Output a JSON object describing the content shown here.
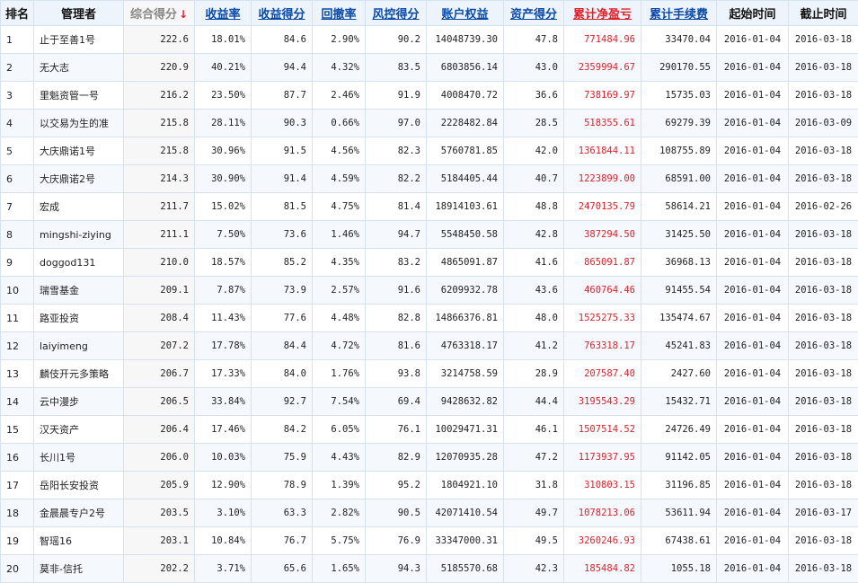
{
  "headers": {
    "rank": "排名",
    "manager": "管理者",
    "score": "综合得分",
    "return_rate": "收益率",
    "return_score": "收益得分",
    "drawdown": "回撤率",
    "risk_score": "风控得分",
    "equity": "账户权益",
    "asset_score": "资产得分",
    "net_profit": "累计净盈亏",
    "fees": "累计手续费",
    "start": "起始时间",
    "end": "截止时间",
    "sort_arrow": "↓"
  },
  "rows": [
    [
      "1",
      "止于至善1号",
      "222.6",
      "18.01%",
      "84.6",
      "2.90%",
      "90.2",
      "14048739.30",
      "47.8",
      "771484.96",
      "33470.04",
      "2016-01-04",
      "2016-03-18"
    ],
    [
      "2",
      "无大志",
      "220.9",
      "40.21%",
      "94.4",
      "4.32%",
      "83.5",
      "6803856.14",
      "43.0",
      "2359994.67",
      "290170.55",
      "2016-01-04",
      "2016-03-18"
    ],
    [
      "3",
      "里魁资管一号",
      "216.2",
      "23.50%",
      "87.7",
      "2.46%",
      "91.9",
      "4008470.72",
      "36.6",
      "738169.97",
      "15735.03",
      "2016-01-04",
      "2016-03-18"
    ],
    [
      "4",
      "以交易为生的准",
      "215.8",
      "28.11%",
      "90.3",
      "0.66%",
      "97.0",
      "2228482.84",
      "28.5",
      "518355.61",
      "69279.39",
      "2016-01-04",
      "2016-03-09"
    ],
    [
      "5",
      "大庆鼎诺1号",
      "215.8",
      "30.96%",
      "91.5",
      "4.56%",
      "82.3",
      "5760781.85",
      "42.0",
      "1361844.11",
      "108755.89",
      "2016-01-04",
      "2016-03-18"
    ],
    [
      "6",
      "大庆鼎诺2号",
      "214.3",
      "30.90%",
      "91.4",
      "4.59%",
      "82.2",
      "5184405.44",
      "40.7",
      "1223899.00",
      "68591.00",
      "2016-01-04",
      "2016-03-18"
    ],
    [
      "7",
      "宏成",
      "211.7",
      "15.02%",
      "81.5",
      "4.75%",
      "81.4",
      "18914103.61",
      "48.8",
      "2470135.79",
      "58614.21",
      "2016-01-04",
      "2016-02-26"
    ],
    [
      "8",
      "mingshi-ziying",
      "211.1",
      "7.50%",
      "73.6",
      "1.46%",
      "94.7",
      "5548450.58",
      "42.8",
      "387294.50",
      "31425.50",
      "2016-01-04",
      "2016-03-18"
    ],
    [
      "9",
      "doggod131",
      "210.0",
      "18.57%",
      "85.2",
      "4.35%",
      "83.2",
      "4865091.87",
      "41.6",
      "865091.87",
      "36968.13",
      "2016-01-04",
      "2016-03-18"
    ],
    [
      "10",
      "瑞雪基金",
      "209.1",
      "7.87%",
      "73.9",
      "2.57%",
      "91.6",
      "6209932.78",
      "43.6",
      "460764.46",
      "91455.54",
      "2016-01-04",
      "2016-03-18"
    ],
    [
      "11",
      "路亚投资",
      "208.4",
      "11.43%",
      "77.6",
      "4.48%",
      "82.8",
      "14866376.81",
      "48.0",
      "1525275.33",
      "135474.67",
      "2016-01-04",
      "2016-03-18"
    ],
    [
      "12",
      "laiyimeng",
      "207.2",
      "17.78%",
      "84.4",
      "4.72%",
      "81.6",
      "4763318.17",
      "41.2",
      "763318.17",
      "45241.83",
      "2016-01-04",
      "2016-03-18"
    ],
    [
      "13",
      "麟伎开元多策略",
      "206.7",
      "17.33%",
      "84.0",
      "1.76%",
      "93.8",
      "3214758.59",
      "28.9",
      "207587.40",
      "2427.60",
      "2016-01-04",
      "2016-03-18"
    ],
    [
      "14",
      "云中漫步",
      "206.5",
      "33.84%",
      "92.7",
      "7.54%",
      "69.4",
      "9428632.82",
      "44.4",
      "3195543.29",
      "15432.71",
      "2016-01-04",
      "2016-03-18"
    ],
    [
      "15",
      "汉天资产",
      "206.4",
      "17.46%",
      "84.2",
      "6.05%",
      "76.1",
      "10029471.31",
      "46.1",
      "1507514.52",
      "24726.49",
      "2016-01-04",
      "2016-03-18"
    ],
    [
      "16",
      "长川1号",
      "206.0",
      "10.03%",
      "75.9",
      "4.43%",
      "82.9",
      "12070935.28",
      "47.2",
      "1173937.95",
      "91142.05",
      "2016-01-04",
      "2016-03-18"
    ],
    [
      "17",
      "岳阳长安投资",
      "205.9",
      "12.90%",
      "78.9",
      "1.39%",
      "95.2",
      "1804921.10",
      "31.8",
      "310803.15",
      "31196.85",
      "2016-01-04",
      "2016-03-18"
    ],
    [
      "18",
      "金晨晨专户2号",
      "203.5",
      "3.10%",
      "63.3",
      "2.82%",
      "90.5",
      "42071410.54",
      "49.7",
      "1078213.06",
      "53611.94",
      "2016-01-04",
      "2016-03-17"
    ],
    [
      "19",
      "智瑶16",
      "203.1",
      "10.84%",
      "76.7",
      "5.75%",
      "76.9",
      "33347000.31",
      "49.5",
      "3260246.93",
      "67438.61",
      "2016-01-04",
      "2016-03-18"
    ],
    [
      "20",
      "莫非-信托",
      "202.2",
      "3.71%",
      "65.6",
      "1.65%",
      "94.3",
      "5185570.68",
      "42.3",
      "185484.82",
      "1055.18",
      "2016-01-04",
      "2016-03-18"
    ]
  ]
}
